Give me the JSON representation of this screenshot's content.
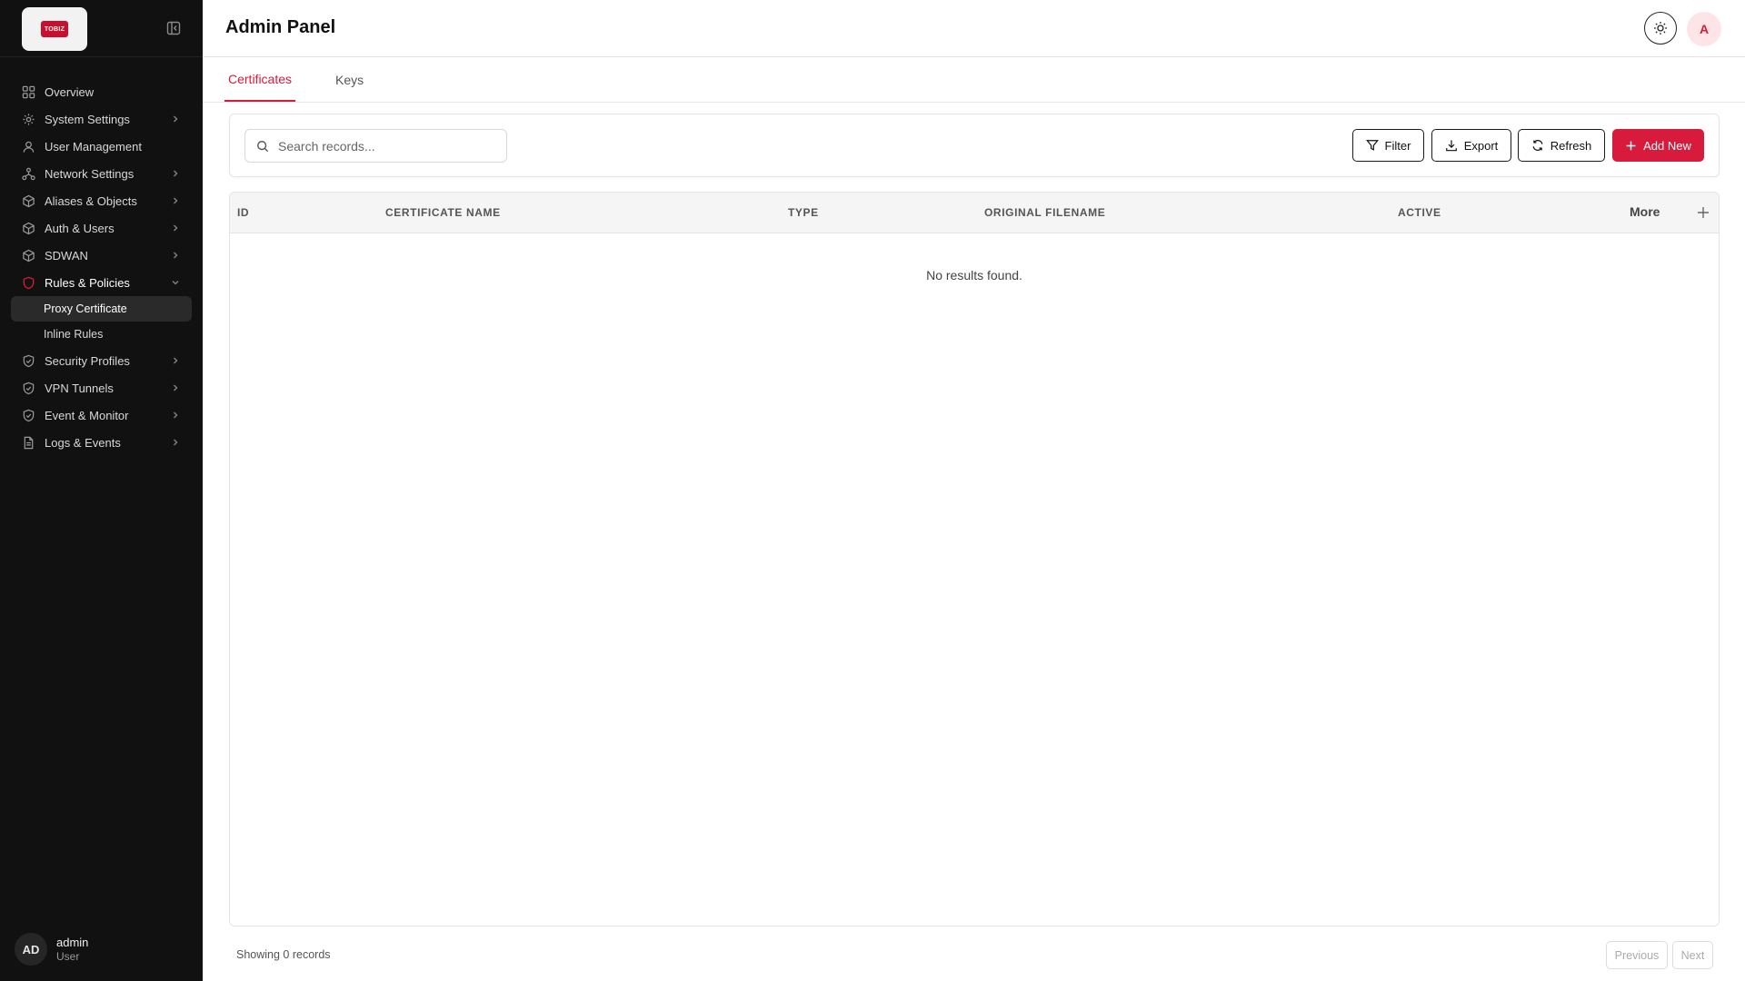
{
  "sidebar": {
    "logo_text": "TOBIZ",
    "items": [
      {
        "label": "Overview",
        "icon": "grid-icon"
      },
      {
        "label": "System Settings",
        "icon": "gear-icon"
      },
      {
        "label": "User Management",
        "icon": "user-icon"
      },
      {
        "label": "Network Settings",
        "icon": "network-icon"
      },
      {
        "label": "Aliases & Objects",
        "icon": "cube-icon"
      },
      {
        "label": "Auth & Users",
        "icon": "cube-icon"
      },
      {
        "label": "SDWAN",
        "icon": "cube-icon"
      },
      {
        "label": "Rules & Policies",
        "icon": "shield-icon"
      },
      {
        "label": "Security Profiles",
        "icon": "shield-check-icon"
      },
      {
        "label": "VPN Tunnels",
        "icon": "shield-check-icon"
      },
      {
        "label": "Event & Monitor",
        "icon": "shield-check-icon"
      },
      {
        "label": "Logs & Events",
        "icon": "document-icon"
      }
    ],
    "subitems": [
      {
        "label": "Proxy Certificate",
        "selected": true
      },
      {
        "label": "Inline Rules",
        "selected": false
      }
    ],
    "user": {
      "initials": "AD",
      "name": "admin",
      "role": "User"
    }
  },
  "header": {
    "title": "Admin Panel",
    "avatar_letter": "A"
  },
  "tabs": [
    {
      "label": "Certificates",
      "active": true
    },
    {
      "label": "Keys",
      "active": false
    }
  ],
  "toolbar": {
    "search_placeholder": "Search records...",
    "filter_label": "Filter",
    "export_label": "Export",
    "refresh_label": "Refresh",
    "add_label": "Add New"
  },
  "table": {
    "columns": [
      "ID",
      "CERTIFICATE NAME",
      "TYPE",
      "ORIGINAL FILENAME",
      "ACTIVE"
    ],
    "more_label": "More",
    "empty_message": "No results found."
  },
  "footer": {
    "records_text": "Showing 0 records",
    "previous_label": "Previous",
    "next_label": "Next"
  },
  "colors": {
    "accent": "#d81b3c",
    "sidebar_bg": "#111111"
  }
}
